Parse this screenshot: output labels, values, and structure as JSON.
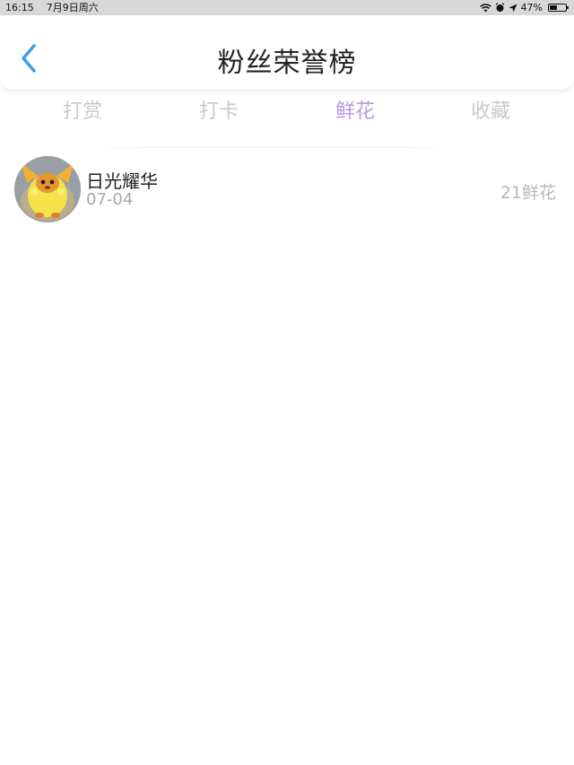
{
  "status_bar": {
    "time": "16:15",
    "date": "7月9日周六",
    "battery_percent": "47%",
    "battery_level": 0.47,
    "icons": [
      "wifi-icon",
      "alarm-icon",
      "location-arrow-icon",
      "battery-icon"
    ]
  },
  "header": {
    "title": "粉丝荣誉榜",
    "back_icon": "chevron-left-icon"
  },
  "tabs": [
    {
      "label": "打赏",
      "active": false
    },
    {
      "label": "打卡",
      "active": false
    },
    {
      "label": "鲜花",
      "active": true
    },
    {
      "label": "收藏",
      "active": false
    }
  ],
  "colors": {
    "accent": "#b79be0",
    "back_icon": "#3aa0e8",
    "inactive_tab": "#c9c9c9",
    "status_bar_bg": "#d8d8d8"
  },
  "list": [
    {
      "name": "日光耀华",
      "date": "07-04",
      "amount": "21鲜花"
    }
  ]
}
